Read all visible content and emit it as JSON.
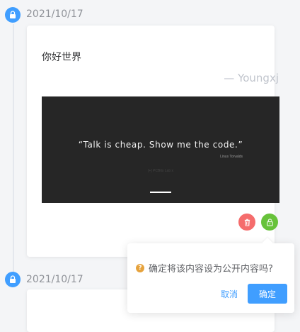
{
  "colors": {
    "timeline_dot": "#409eff",
    "delete_button": "#f56c6c",
    "public_button": "#67c23a",
    "warning_icon": "#e6a23c",
    "primary": "#409eff"
  },
  "timeline": [
    {
      "date": "2021/10/17",
      "icon": "lock-icon",
      "content": "你好世界",
      "signature": "— Youngxj",
      "image": {
        "quote": "“Talk is cheap. Show me the code.”",
        "author": "Linus Torvalds",
        "faded_text": "[+] PCBits Lab x"
      },
      "actions": {
        "delete_icon": "trash-icon",
        "public_icon": "unlock-icon"
      }
    },
    {
      "date": "2021/10/17",
      "icon": "lock-icon"
    }
  ],
  "popconfirm": {
    "icon": "question-icon",
    "icon_glyph": "?",
    "message": "确定将该内容设为公开内容吗?",
    "cancel_label": "取消",
    "confirm_label": "确定"
  }
}
